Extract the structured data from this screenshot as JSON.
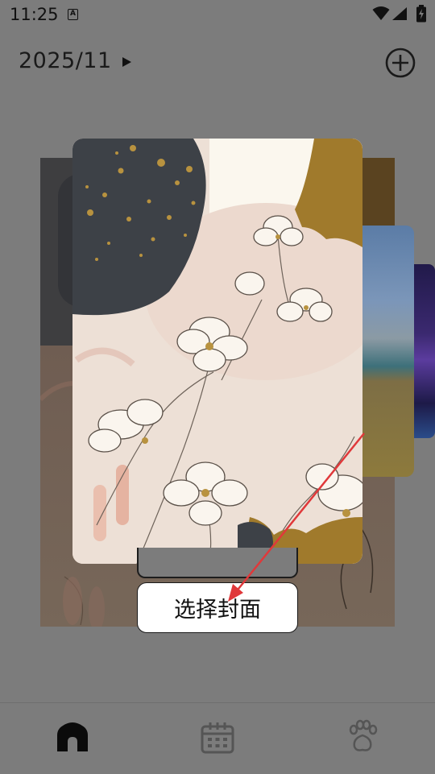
{
  "status_bar": {
    "time": "11:25",
    "notification_icon": "a-notification-icon",
    "wifi_icon": "wifi-icon",
    "signal_icon": "signal-icon",
    "battery_icon": "battery-charging-icon"
  },
  "header": {
    "month": "2025/11",
    "month_toggle_icon": "play-triangle-icon",
    "add_icon": "plus-circle-icon"
  },
  "cover_picker": {
    "selected_cover": "floral-illustration",
    "other_covers": [
      "floral-dark-background",
      "beach-landscape",
      "purple-galaxy"
    ],
    "choose_button_label": "选择封面"
  },
  "bottom_nav": {
    "items": [
      {
        "name": "home",
        "icon": "house-icon",
        "active": true
      },
      {
        "name": "calendar",
        "icon": "calendar-icon",
        "active": false
      },
      {
        "name": "pet",
        "icon": "paw-icon",
        "active": false
      }
    ]
  },
  "colors": {
    "overlay": "#7c7c7c",
    "annotation_arrow": "#e0383a",
    "button_bg": "#ffffff"
  }
}
